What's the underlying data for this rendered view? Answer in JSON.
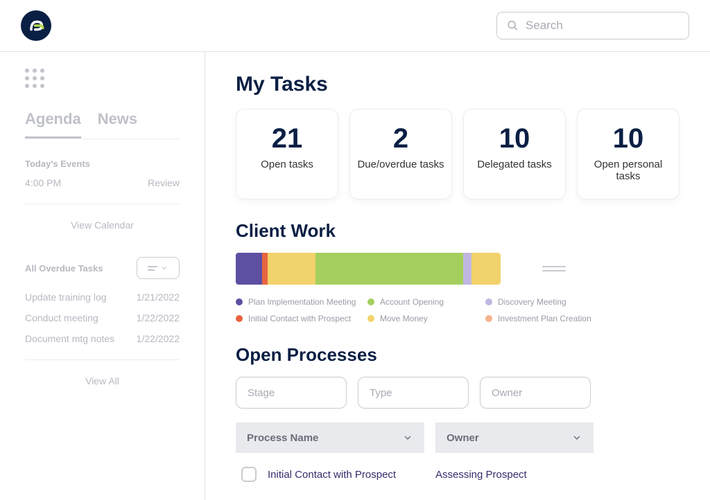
{
  "header": {
    "search_placeholder": "Search"
  },
  "sidebar": {
    "tabs": {
      "agenda": "Agenda",
      "news": "News"
    },
    "todays_events_label": "Today's Events",
    "events": [
      {
        "time": "4:00 PM",
        "title": "Review"
      }
    ],
    "view_calendar": "View Calendar",
    "overdue_label": "All Overdue Tasks",
    "overdue": [
      {
        "title": "Update training log",
        "date": "1/21/2022"
      },
      {
        "title": "Conduct meeting",
        "date": "1/22/2022"
      },
      {
        "title": "Document mtg notes",
        "date": "1/22/2022"
      }
    ],
    "view_all": "View All"
  },
  "main": {
    "my_tasks_title": "My Tasks",
    "cards": [
      {
        "num": "21",
        "label": "Open tasks"
      },
      {
        "num": "2",
        "label": "Due/overdue tasks"
      },
      {
        "num": "10",
        "label": "Delegated tasks"
      },
      {
        "num": "10",
        "label": "Open personal tasks"
      }
    ],
    "client_work_title": "Client Work",
    "segments": [
      {
        "color": "#5d4fa2",
        "pct": 10
      },
      {
        "color": "#e8643f",
        "pct": 2
      },
      {
        "color": "#f2d26a",
        "pct": 18
      },
      {
        "color": "#a4cf5f",
        "pct": 56
      },
      {
        "color": "#bfb7e0",
        "pct": 3
      },
      {
        "color": "#f2d26a",
        "pct": 11
      }
    ],
    "legend": [
      {
        "color": "#5d4fa2",
        "label": "Plan Implementation Meeting"
      },
      {
        "color": "#a4cf5f",
        "label": "Account Opening"
      },
      {
        "color": "#bfb7e0",
        "label": "Discovery Meeting"
      },
      {
        "color": "#e8643f",
        "label": "Initial Contact with Prospect"
      },
      {
        "color": "#f2d26a",
        "label": "Move Money"
      },
      {
        "color": "#f6b28b",
        "label": "Investment Plan Creation"
      }
    ],
    "open_processes_title": "Open Processes",
    "filters": {
      "stage": "Stage",
      "type": "Type",
      "owner": "Owner"
    },
    "table": {
      "head": {
        "process": "Process Name",
        "owner": "Owner"
      },
      "rows": [
        {
          "process": "Initial Contact with Prospect",
          "owner": "Assessing Prospect"
        }
      ]
    }
  }
}
